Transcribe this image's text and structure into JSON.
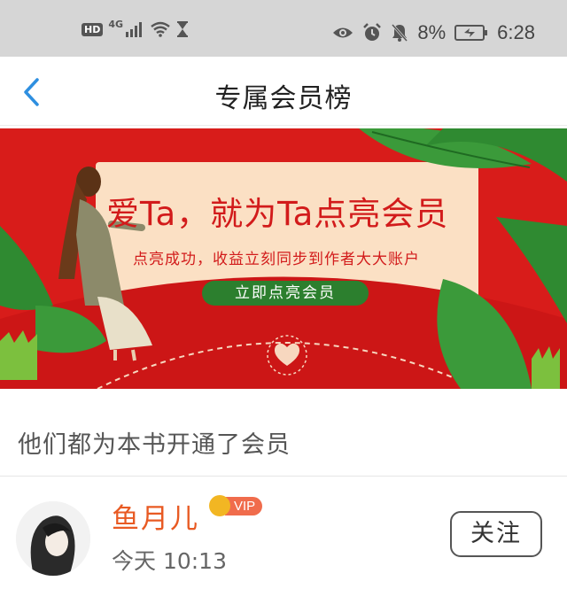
{
  "status_bar": {
    "hd": "HD",
    "network": "4G",
    "battery": "8%",
    "time": "6:28",
    "icons": [
      "signal-icon",
      "wifi-icon",
      "hourglass-icon",
      "eye-icon",
      "alarm-icon",
      "bell-off-icon",
      "battery-icon"
    ]
  },
  "nav": {
    "title": "专属会员榜",
    "back_icon": "chevron-left-icon"
  },
  "banner": {
    "headline": "爱Ta，就为Ta点亮会员",
    "subtitle": "点亮成功，收益立刻同步到作者大大账户",
    "button": "立即点亮会员"
  },
  "section": {
    "title": "他们都为本书开通了会员"
  },
  "members": [
    {
      "name": "鱼月儿",
      "badge": "VIP",
      "time": "今天 10:13",
      "follow": "关注"
    }
  ],
  "colors": {
    "accent_red": "#d81c1a",
    "name_orange": "#e85a23",
    "back_blue": "#2e8fe0",
    "button_green": "#2c7f2e"
  }
}
